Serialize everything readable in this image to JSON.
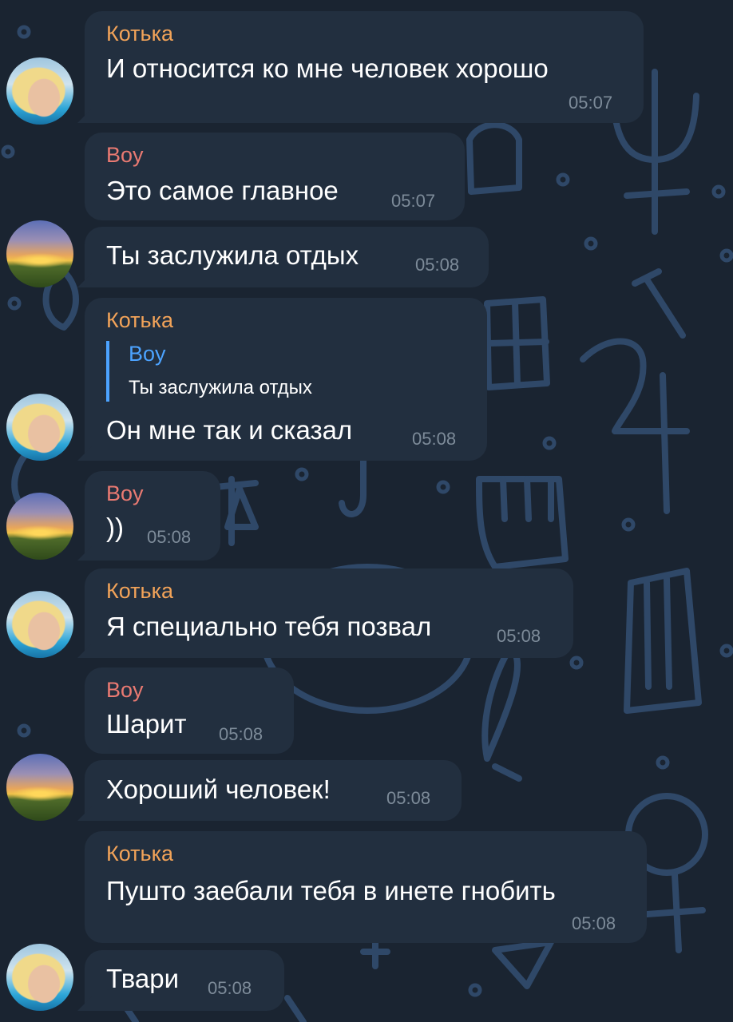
{
  "theme": {
    "background": "#1a2431",
    "bubble": "#222f3f",
    "pattern": "#2f4868",
    "kotka_name_color": "#f2a359",
    "boy_name_color": "#ea7a72",
    "quote_accent": "#4ca3ff",
    "time_color": "#7d8b99"
  },
  "messages": [
    {
      "sender": "Котька",
      "text": "И относится ко мне человек хорошо",
      "time": "05:07"
    },
    {
      "sender": "Boy",
      "text": "Это самое главное",
      "time": "05:07"
    },
    {
      "text": "Ты заслужила отдых",
      "time": "05:08"
    },
    {
      "sender": "Котька",
      "reply_to": {
        "sender": "Boy",
        "text": "Ты заслужила отдых"
      },
      "text": "Он мне так и сказал",
      "time": "05:08"
    },
    {
      "sender": "Boy",
      "text": "))",
      "time": "05:08"
    },
    {
      "sender": "Котька",
      "text": "Я специально тебя позвал",
      "time": "05:08"
    },
    {
      "sender": "Boy",
      "text": "Шарит",
      "time": "05:08"
    },
    {
      "text": "Хороший человек!",
      "time": "05:08"
    },
    {
      "sender": "Котька",
      "text": "Пушто заебали тебя в инете гнобить",
      "time": "05:08"
    },
    {
      "text": "Твари",
      "time": "05:08"
    }
  ]
}
